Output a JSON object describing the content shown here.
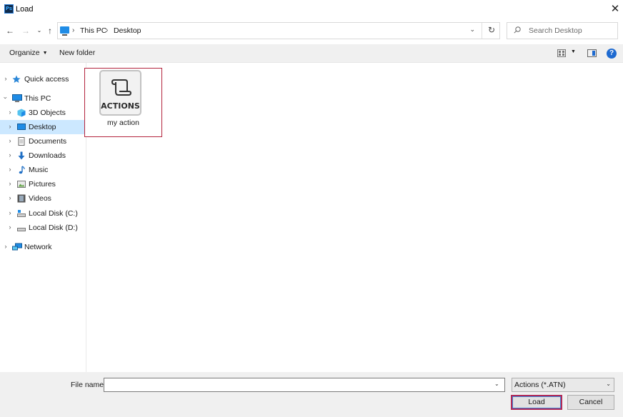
{
  "window": {
    "title": "Load",
    "app_icon_text": "Ps"
  },
  "address": {
    "crumbs": [
      "This PC",
      "Desktop"
    ]
  },
  "search": {
    "placeholder": "Search Desktop"
  },
  "toolbar": {
    "organize_label": "Organize",
    "new_folder_label": "New folder",
    "help_glyph": "?"
  },
  "sidebar": {
    "items": [
      {
        "label": "Quick access",
        "icon": "star-icon"
      },
      {
        "label": "This PC",
        "icon": "computer-icon"
      },
      {
        "label": "3D Objects",
        "icon": "cube-icon"
      },
      {
        "label": "Desktop",
        "icon": "desktop-icon",
        "selected": true
      },
      {
        "label": "Documents",
        "icon": "document-icon"
      },
      {
        "label": "Downloads",
        "icon": "download-arrow-icon"
      },
      {
        "label": "Music",
        "icon": "music-note-icon"
      },
      {
        "label": "Pictures",
        "icon": "picture-icon"
      },
      {
        "label": "Videos",
        "icon": "film-icon"
      },
      {
        "label": "Local Disk (C:)",
        "icon": "drive-icon"
      },
      {
        "label": "Local Disk (D:)",
        "icon": "drive-icon"
      },
      {
        "label": "Network",
        "icon": "network-icon"
      }
    ]
  },
  "files": [
    {
      "name": "my action",
      "thumbnail_text": "ACTIONS",
      "icon": "actions-file-icon"
    }
  ],
  "bottom": {
    "file_name_label": "File name:",
    "file_name_value": "",
    "file_type": "Actions (*.ATN)",
    "load_label": "Load",
    "cancel_label": "Cancel"
  },
  "colors": {
    "selection": "#cce8ff",
    "accent": "#1e6ad0",
    "focus_border": "#b3243d"
  }
}
